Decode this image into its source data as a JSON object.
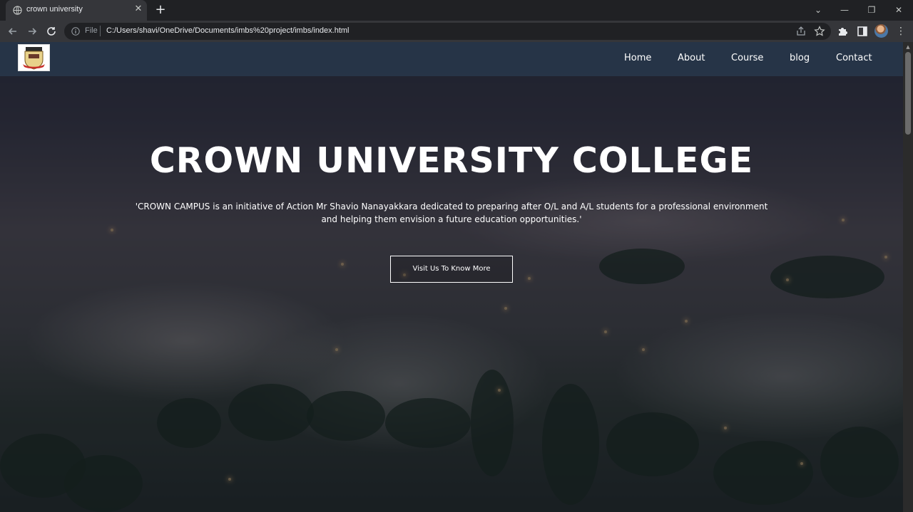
{
  "browser": {
    "tab_title": "crown university",
    "tab_close": "✕",
    "new_tab": "+",
    "omnibox_file_label": "File",
    "url": "C:/Users/shavi/OneDrive/Documents/imbs%20project/imbs/index.html",
    "icons": {
      "back": "back-arrow-icon",
      "forward": "forward-arrow-icon",
      "reload": "reload-icon",
      "info": "info-icon",
      "share": "share-icon",
      "bookmark": "star-icon",
      "extensions": "puzzle-icon",
      "sidepanel": "side-panel-icon",
      "profile": "avatar",
      "menu": "kebab-menu-icon"
    },
    "window_controls": {
      "tab_search": "⌄",
      "minimize": "—",
      "maximize": "❐",
      "close": "✕"
    }
  },
  "site": {
    "nav": {
      "items": [
        {
          "label": "Home"
        },
        {
          "label": "About"
        },
        {
          "label": "Course"
        },
        {
          "label": "blog"
        },
        {
          "label": "Contact"
        }
      ]
    },
    "hero": {
      "title": "CROWN UNIVERSITY COLLEGE",
      "quote": "'CROWN CAMPUS is an initiative of Action Mr Shavio Nanayakkara dedicated to preparing after O/L and A/L students for a professional environment and helping them envision a future education opportunities.'",
      "cta_label": "Visit Us To Know More"
    }
  },
  "colors": {
    "chrome_dark": "#202124",
    "chrome_tab": "#35363a",
    "nav_bar": "#283748",
    "text_white": "#ffffff"
  }
}
